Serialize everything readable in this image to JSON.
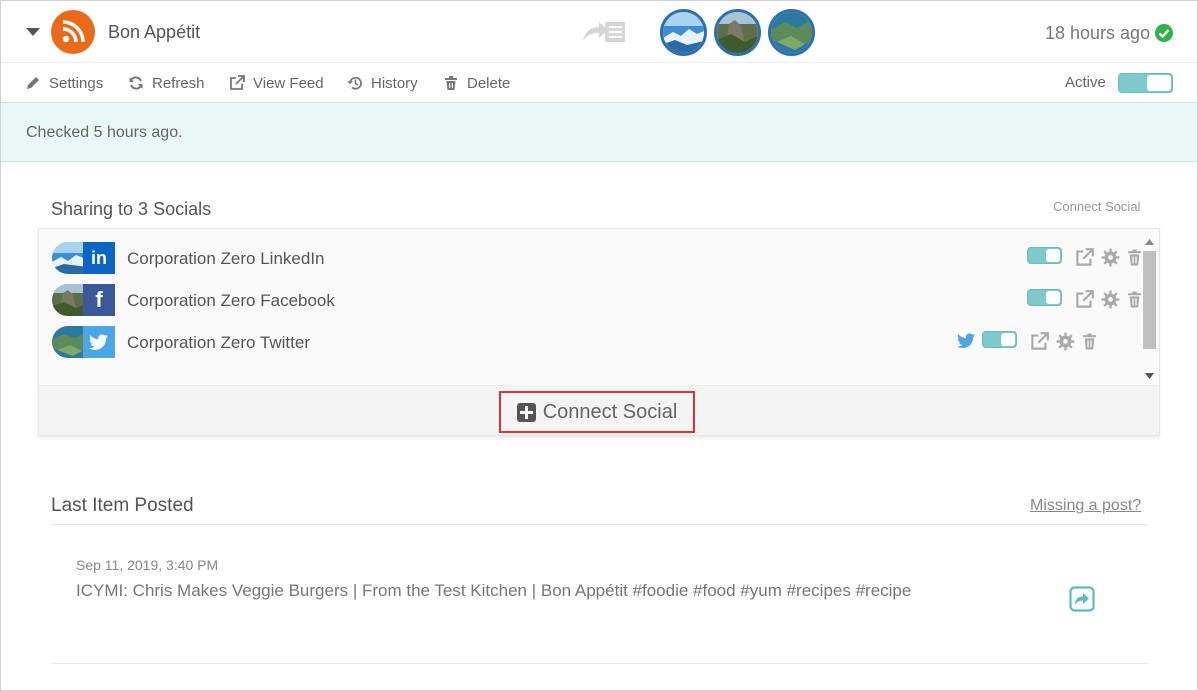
{
  "header": {
    "feed_name": "Bon Appétit",
    "time_ago": "18 hours ago",
    "icons": [
      "chevron-down-icon",
      "rss-icon",
      "share-to-list-icon",
      "check-circle-icon"
    ]
  },
  "toolbar": {
    "settings": "Settings",
    "refresh": "Refresh",
    "view_feed": "View Feed",
    "history": "History",
    "delete": "Delete",
    "active_label": "Active",
    "active": true
  },
  "info": {
    "checked": "Checked 5 hours ago."
  },
  "sharing": {
    "title": "Sharing to 3 Socials",
    "connect_link": "Connect Social",
    "connect_button": "Connect Social",
    "socials": [
      {
        "name": "Corporation Zero LinkedIn",
        "network": "linkedin",
        "brand_glyph": "in",
        "brand_color": "#0a66c2",
        "enabled": true,
        "extra_icon": ""
      },
      {
        "name": "Corporation Zero Facebook",
        "network": "facebook",
        "brand_glyph": "f",
        "brand_color": "#3b5998",
        "enabled": true,
        "extra_icon": ""
      },
      {
        "name": "Corporation Zero Twitter",
        "network": "twitter",
        "brand_glyph": "bird",
        "brand_color": "#4aa6e6",
        "enabled": true,
        "extra_icon": "twitter-icon"
      }
    ]
  },
  "last_item": {
    "title": "Last Item Posted",
    "missing_link": "Missing a post?",
    "date": "Sep 11, 2019, 3:40 PM",
    "text": "ICYMI: Chris Makes Veggie Burgers | From the Test Kitchen | Bon Appétit #foodie #food #yum #recipes #recipe"
  },
  "colors": {
    "accent": "#7dc9cb",
    "rss": "#ea6a1a",
    "success": "#33b24a",
    "highlight_border": "#d9333a",
    "info_bg": "#eaf7f7"
  }
}
